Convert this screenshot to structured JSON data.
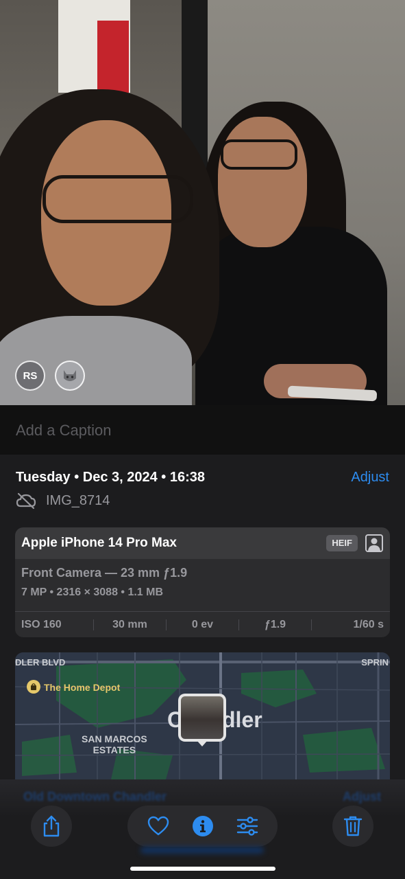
{
  "people": {
    "initials": "RS",
    "second_face_icon": "cat-face-icon"
  },
  "caption": {
    "placeholder": "Add a Caption"
  },
  "info": {
    "date": "Tuesday • Dec 3, 2024 • 16:38",
    "adjust_label": "Adjust",
    "cloud_icon": "cloud-off-icon",
    "filename": "IMG_8714"
  },
  "camera": {
    "device": "Apple iPhone 14 Pro Max",
    "format_badge": "HEIF",
    "portrait_icon": "portrait-mode-icon",
    "lens": "Front Camera — 23 mm ƒ1.9",
    "specs": "7 MP  •  2316 × 3088  •  1.1 MB",
    "exif": [
      "ISO 160",
      "30 mm",
      "0 ev",
      "ƒ1.9",
      "1/60 s"
    ]
  },
  "map": {
    "road_left": "DLER BLVD",
    "road_right": "SPRIN",
    "poi": "The Home Depot",
    "neighborhood_line1": "SAN MARCOS",
    "neighborhood_line2": "ESTATES",
    "city": "Chandler",
    "location_title": "Old Downtown Chandler",
    "location_adjust": "Adjust"
  },
  "toolbar": {
    "share_icon": "share-icon",
    "favorite_icon": "heart-icon",
    "info_icon": "info-icon",
    "edit_icon": "adjust-sliders-icon",
    "delete_icon": "trash-icon"
  },
  "colors": {
    "accent": "#2d8cf0",
    "panel": "#1c1c1e",
    "card": "#2c2c2e",
    "muted": "#98989d"
  }
}
